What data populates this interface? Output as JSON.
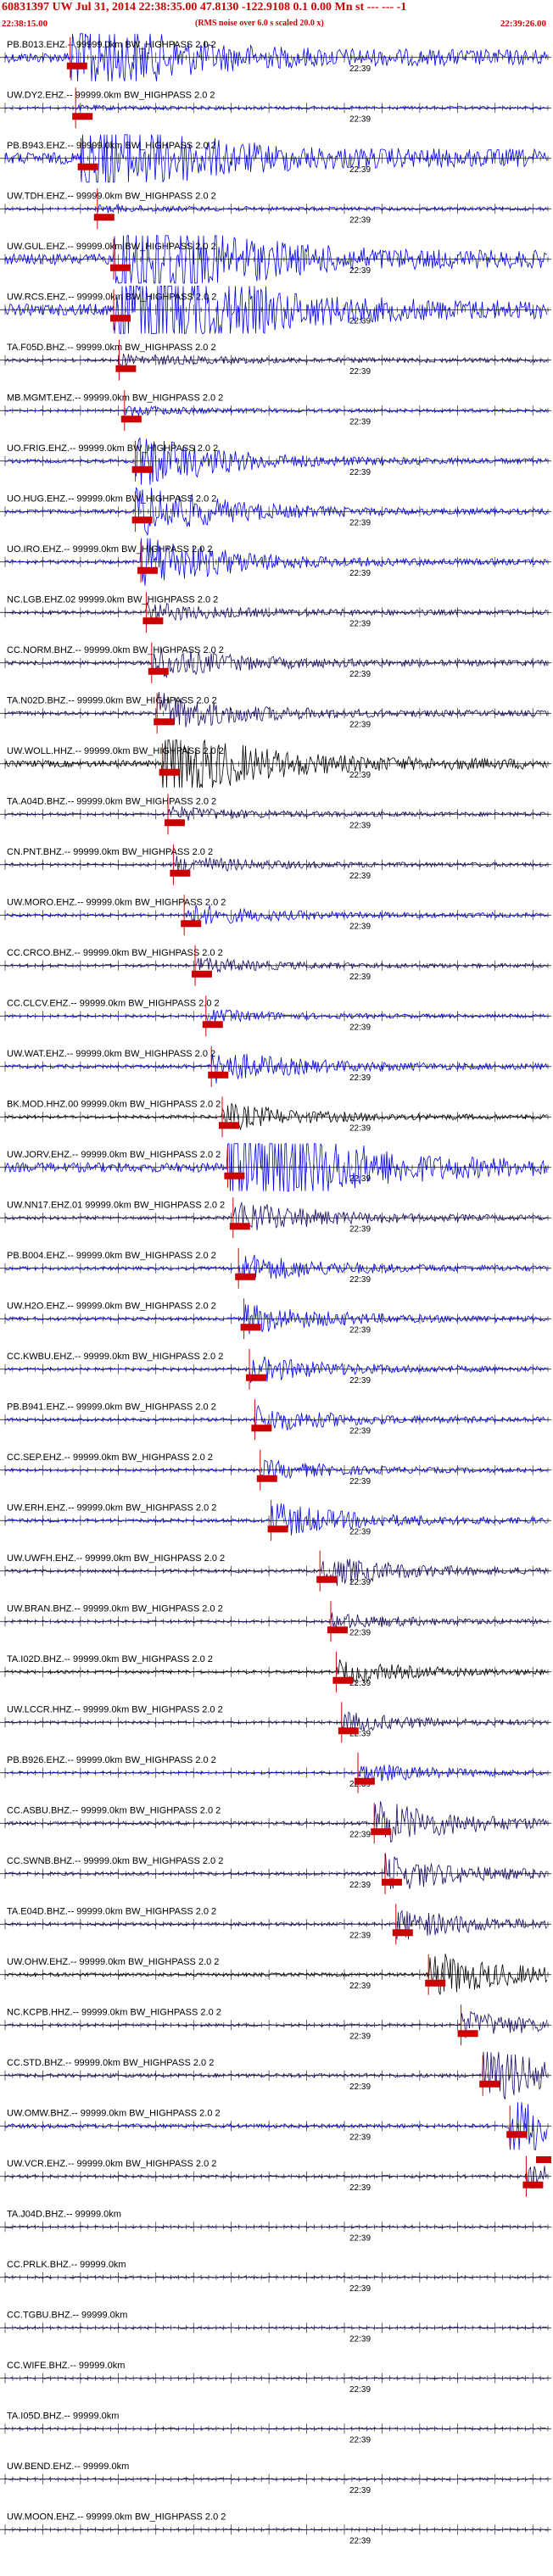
{
  "header": {
    "title": "60831397 UW Jul 31, 2014 22:38:35.00   47.8130 -122.9108  0.1 0.00 Mn st --- --- -1",
    "subtitle": "(RMS noise over 6.0 s scaled 20.0 x)",
    "start_time": "22:38:15.00",
    "end_time": "22:39:26.00"
  },
  "tick_label": "22:39",
  "colors": {
    "pick": "#cc0000",
    "wave_blue": "#0000ee",
    "wave_navy": "#1a0a6a",
    "wave_black": "#000000"
  },
  "stations": [
    {
      "label": "PB.B013.EHZ.-- 99999.0km BW_HIGHPASS  2.0  2",
      "color": "blue",
      "amp": 1.4,
      "pick": 0.12,
      "ev": 0.55
    },
    {
      "label": "UW.DY2.EHZ.-- 99999.0km BW_HIGHPASS  2.0  2",
      "color": "blue",
      "amp": 0.25,
      "pick": 0.13,
      "ev": 0.1
    },
    {
      "label": "PB.B943.EHZ.-- 99999.0km BW_HIGHPASS  2.0  2",
      "color": "blue",
      "amp": 1.6,
      "pick": 0.14,
      "ev": 0.6
    },
    {
      "label": "UW.TDH.EHZ.-- 99999.0km BW_HIGHPASS  2.0  2",
      "color": "blue",
      "amp": 0.3,
      "pick": 0.17,
      "ev": 0.15
    },
    {
      "label": "UW.GUL.EHZ.-- 99999.0km BW_HIGHPASS  2.0  2",
      "color": "blue",
      "amp": 1.5,
      "pick": 0.2,
      "ev": 0.9
    },
    {
      "label": "UW.RCS.EHZ.-- 99999.0km BW_HIGHPASS  2.0  2",
      "color": "blue",
      "amp": 1.6,
      "pick": 0.2,
      "ev": 1.0
    },
    {
      "label": "TA.F05D.BHZ.-- 99999.0km BW_HIGHPASS  2.0  2",
      "color": "navy",
      "amp": 0.4,
      "pick": 0.21,
      "ev": 0.2
    },
    {
      "label": "MB.MGMT.EHZ.-- 99999.0km BW_HIGHPASS  2.0  2",
      "color": "blue",
      "amp": 0.25,
      "pick": 0.22,
      "ev": 0.3
    },
    {
      "label": "UO.FRIG.EHZ.-- 99999.0km BW_HIGHPASS  2.0  2",
      "color": "blue",
      "amp": 0.5,
      "pick": 0.24,
      "ev": 0.9
    },
    {
      "label": "UO.HUG.EHZ.-- 99999.0km BW_HIGHPASS  2.0  2",
      "color": "blue",
      "amp": 0.5,
      "pick": 0.24,
      "ev": 0.9
    },
    {
      "label": "UO.IRO.EHZ.-- 99999.0km BW_HIGHPASS  2.0  2",
      "color": "blue",
      "amp": 0.5,
      "pick": 0.25,
      "ev": 0.9
    },
    {
      "label": "NC.LGB.EHZ.02 99999.0km BW_HIGHPASS  2.0  2",
      "color": "navy",
      "amp": 0.45,
      "pick": 0.26,
      "ev": 0.3
    },
    {
      "label": "CC.NORM.BHZ.-- 99999.0km BW_HIGHPASS  2.0  2",
      "color": "navy",
      "amp": 0.5,
      "pick": 0.27,
      "ev": 0.5
    },
    {
      "label": "TA.N02D.BHZ.-- 99999.0km BW_HIGHPASS  2.0  2",
      "color": "navy",
      "amp": 0.5,
      "pick": 0.28,
      "ev": 0.6
    },
    {
      "label": "UW.WOLL.HHZ.-- 99999.0km BW_HIGHPASS  2.0  2",
      "color": "black",
      "amp": 0.9,
      "pick": 0.29,
      "ev": 0.7
    },
    {
      "label": "TA.A04D.BHZ.-- 99999.0km BW_HIGHPASS  2.0  2",
      "color": "navy",
      "amp": 0.35,
      "pick": 0.3,
      "ev": 0.3
    },
    {
      "label": "CN.PNT.BHZ.-- 99999.0km BW_HIGHPASS  2.0  2",
      "color": "navy",
      "amp": 0.35,
      "pick": 0.31,
      "ev": 0.4
    },
    {
      "label": "UW.MORO.EHZ.-- 99999.0km BW_HIGHPASS  2.0  2",
      "color": "blue",
      "amp": 0.4,
      "pick": 0.33,
      "ev": 0.4
    },
    {
      "label": "CC.CRCO.BHZ.-- 99999.0km BW_HIGHPASS  2.0  2",
      "color": "navy",
      "amp": 0.35,
      "pick": 0.35,
      "ev": 0.3
    },
    {
      "label": "CC.CLCV.EHZ.-- 99999.0km BW_HIGHPASS  2.0  2",
      "color": "blue",
      "amp": 0.3,
      "pick": 0.37,
      "ev": 0.3
    },
    {
      "label": "UW.WAT.EHZ.-- 99999.0km BW_HIGHPASS  2.0  2",
      "color": "blue",
      "amp": 0.5,
      "pick": 0.38,
      "ev": 0.5
    },
    {
      "label": "BK.MOD.HHZ.00 99999.0km BW_HIGHPASS  2.0  2",
      "color": "black",
      "amp": 0.4,
      "pick": 0.4,
      "ev": 0.5
    },
    {
      "label": "UW.JORV.EHZ.-- 99999.0km BW_HIGHPASS  2.0  2",
      "color": "blue",
      "amp": 1.3,
      "pick": 0.41,
      "ev": 1.0
    },
    {
      "label": "UW.NN17.EHZ.01 99999.0km BW_HIGHPASS  2.0  2",
      "color": "navy",
      "amp": 0.45,
      "pick": 0.42,
      "ev": 0.6
    },
    {
      "label": "PB.B004.EHZ.-- 99999.0km BW_HIGHPASS  2.0  2",
      "color": "blue",
      "amp": 0.45,
      "pick": 0.43,
      "ev": 0.5
    },
    {
      "label": "UW.H2O.EHZ.-- 99999.0km BW_HIGHPASS  2.0  2",
      "color": "blue",
      "amp": 0.45,
      "pick": 0.44,
      "ev": 0.5
    },
    {
      "label": "CC.KWBU.EHZ.-- 99999.0km BW_HIGHPASS  2.0  2",
      "color": "blue",
      "amp": 0.4,
      "pick": 0.45,
      "ev": 0.5
    },
    {
      "label": "PB.B941.EHZ.-- 99999.0km BW_HIGHPASS  2.0  2",
      "color": "blue",
      "amp": 0.4,
      "pick": 0.46,
      "ev": 0.5
    },
    {
      "label": "CC.SEP.EHZ.-- 99999.0km BW_HIGHPASS  2.0  2",
      "color": "blue",
      "amp": 0.35,
      "pick": 0.47,
      "ev": 0.4
    },
    {
      "label": "UW.ERH.EHZ.-- 99999.0km BW_HIGHPASS  2.0  2",
      "color": "blue",
      "amp": 0.45,
      "pick": 0.49,
      "ev": 0.6
    },
    {
      "label": "UW.UWFH.EHZ.-- 99999.0km BW_HIGHPASS  2.0  2",
      "color": "navy",
      "amp": 0.4,
      "pick": 0.58,
      "ev": 0.6
    },
    {
      "label": "UW.BRAN.BHZ.-- 99999.0km BW_HIGHPASS  2.0  2",
      "color": "navy",
      "amp": 0.3,
      "pick": 0.6,
      "ev": 0.4
    },
    {
      "label": "TA.I02D.BHZ.-- 99999.0km BW_HIGHPASS  2.0  2",
      "color": "black",
      "amp": 0.35,
      "pick": 0.61,
      "ev": 0.5
    },
    {
      "label": "UW.LCCR.HHZ.-- 99999.0km BW_HIGHPASS  2.0  2",
      "color": "navy",
      "amp": 0.3,
      "pick": 0.62,
      "ev": 0.5
    },
    {
      "label": "PB.B926.EHZ.-- 99999.0km BW_HIGHPASS  2.0  2",
      "color": "blue",
      "amp": 0.3,
      "pick": 0.65,
      "ev": 0.5
    },
    {
      "label": "CC.ASBU.BHZ.-- 99999.0km BW_HIGHPASS  2.0  2",
      "color": "navy",
      "amp": 0.45,
      "pick": 0.68,
      "ev": 0.8
    },
    {
      "label": "CC.SWNB.BHZ.-- 99999.0km BW_HIGHPASS  2.0  2",
      "color": "navy",
      "amp": 0.4,
      "pick": 0.7,
      "ev": 0.7
    },
    {
      "label": "TA.E04D.BHZ.-- 99999.0km BW_HIGHPASS  2.0  2",
      "color": "navy",
      "amp": 0.4,
      "pick": 0.72,
      "ev": 0.6
    },
    {
      "label": "UW.OHW.EHZ.-- 99999.0km BW_HIGHPASS  2.0  2",
      "color": "black",
      "amp": 0.45,
      "pick": 0.78,
      "ev": 0.8
    },
    {
      "label": "NC.KCPB.HHZ.-- 99999.0km BW_HIGHPASS  2.0  2",
      "color": "navy",
      "amp": 0.35,
      "pick": 0.84,
      "ev": 0.6
    },
    {
      "label": "CC.STD.BHZ.-- 99999.0km BW_HIGHPASS  2.0  2",
      "color": "navy",
      "amp": 0.5,
      "pick": 0.88,
      "ev": 0.9
    },
    {
      "label": "UW.OMW.BHZ.-- 99999.0km BW_HIGHPASS  2.0  2",
      "color": "blue",
      "amp": 0.55,
      "pick": 0.93,
      "ev": 0.9
    },
    {
      "label": "UW.VCR.EHZ.-- 99999.0km BW_HIGHPASS  2.0  2",
      "color": "navy",
      "amp": 0.35,
      "pick": 0.96,
      "ev": 0.5
    },
    {
      "label": "TA.J04D.BHZ.-- 99999.0km",
      "color": "navy",
      "amp": 0.25,
      "pick": null,
      "ev": 0
    },
    {
      "label": "CC.PRLK.BHZ.-- 99999.0km",
      "color": "navy",
      "amp": 0.25,
      "pick": null,
      "ev": 0
    },
    {
      "label": "CC.TGBU.BHZ.-- 99999.0km",
      "color": "navy",
      "amp": 0.25,
      "pick": null,
      "ev": 0
    },
    {
      "label": "CC.WIFE.BHZ.-- 99999.0km",
      "color": "navy",
      "amp": 0.2,
      "pick": null,
      "ev": 0
    },
    {
      "label": "TA.I05D.BHZ.-- 99999.0km",
      "color": "navy",
      "amp": 0.25,
      "pick": null,
      "ev": 0
    },
    {
      "label": "UW.BEND.EHZ.-- 99999.0km",
      "color": "navy",
      "amp": 0.25,
      "pick": null,
      "ev": 0
    },
    {
      "label": "UW.MOON.EHZ.-- 99999.0km BW_HIGHPASS  2.0  2",
      "color": "navy",
      "amp": 0.2,
      "pick": null,
      "ev": 0
    }
  ]
}
